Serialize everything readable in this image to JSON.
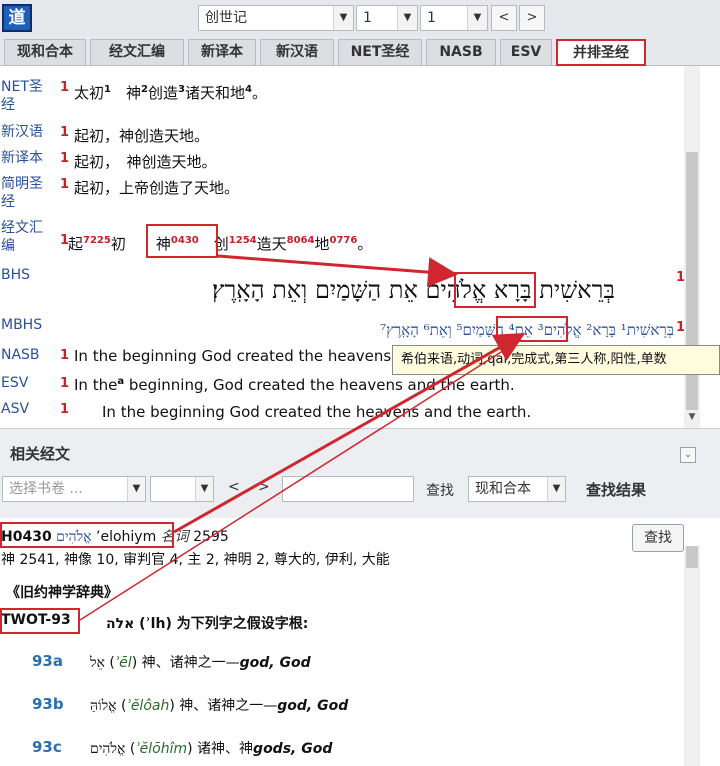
{
  "toolbar": {
    "logo": "道",
    "book": "创世记",
    "chapter": "1",
    "verse": "1",
    "prev": "<",
    "next": ">"
  },
  "tabs": [
    "现和合本",
    "经文汇编",
    "新译本",
    "新汉语",
    "NET圣经",
    "NASB",
    "ESV",
    "并排圣经"
  ],
  "compare": {
    "rows": [
      {
        "label": "NET圣经",
        "num": "1"
      },
      {
        "label": "新汉语",
        "num": "1",
        "text": "起初，神创造天地。"
      },
      {
        "label": "新译本",
        "num": "1",
        "text": "起初，　神创造天地。"
      },
      {
        "label": "简明圣经",
        "num": "1",
        "text": "起初，上帝创造了天地。"
      },
      {
        "label": "经文汇编",
        "num": "1"
      },
      {
        "label": "BHS",
        "num": "1"
      },
      {
        "label": "MBHS",
        "num": "1"
      },
      {
        "label": "NASB",
        "num": "1",
        "text": "In the beginning God created the heavens and the earth."
      },
      {
        "label": "ESV",
        "num": "1"
      },
      {
        "label": "ASV",
        "num": "1",
        "text": "In the beginning God created the heavens and the earth."
      }
    ],
    "net_words": {
      "w1": "太初",
      "s1": "1",
      "w2": "神",
      "s2": "2",
      "w3": "创造",
      "s3": "3",
      "w4": "诸天和地",
      "s4": "4",
      "end": "。"
    },
    "concordance": {
      "w1": "起",
      "s1": "7225",
      "w2": "初",
      "w3": "神",
      "s3": "0430",
      "w4": "创",
      "s4": "1254",
      "w5": "造天",
      "s5": "8064",
      "w6": "地",
      "s6": "0776",
      "end": "。"
    },
    "esv": {
      "a": "In the",
      "sup": "a",
      "b": " beginning, God created the heavens and the earth."
    },
    "bhs_text": "בְּרֵאשִׁית בָּרָא אֱלֹהִים אֵת הַשָּׁמַיִם וְאֵת הָאָֽרֶץ׃",
    "mbhs_text": "בְּרֵאשִׁית¹ בָּרָא² אֱלֹהִים³ אֵת⁴ הַשָּׁמַיִם⁵ וְאֵת⁶ הָאָֽרֶץ⁷",
    "tooltip": "希伯来语,动词,qal,完成式,第三人称,阳性,单数"
  },
  "related": {
    "title": "相关经文",
    "book_placeholder": "选择书卷 ...",
    "find_label": "查找",
    "version": "现和合本",
    "results_title": "查找结果",
    "lt": "<",
    "gt": ">"
  },
  "dict": {
    "code": "H0430",
    "hebrew": "אֱלֹהִים",
    "translit": "’elohiym",
    "pos": "名词",
    "count": "2595",
    "usage": "神 2541, 神像 10, 审判官 4, 主 2, 神明 2, 尊大的, 伊利, 大能",
    "title": "《旧约神学辞典》",
    "twot": "TWOT-93",
    "root": "אלה (ʾlh) 为下列字之假设字根:",
    "find_button": "查找",
    "subs": [
      {
        "num": "93a",
        "heb": "אֵל",
        "tr": "ʾēl",
        "zh": " 神、诸神之一",
        "en": "god, God"
      },
      {
        "num": "93b",
        "heb": "אֱלוֹהַּ",
        "tr": "ʾĕlôah",
        "zh": " 神、诸神之一",
        "en": "god, God"
      },
      {
        "num": "93c",
        "heb": "אֱלֹהִים",
        "tr": "ʾĕlōhîm",
        "zh": " 诸神、神",
        "en": "gods, God"
      }
    ]
  },
  "colors": {
    "accent": "#d0262f",
    "link": "#2a4f9b",
    "strong": "#c8202a"
  }
}
